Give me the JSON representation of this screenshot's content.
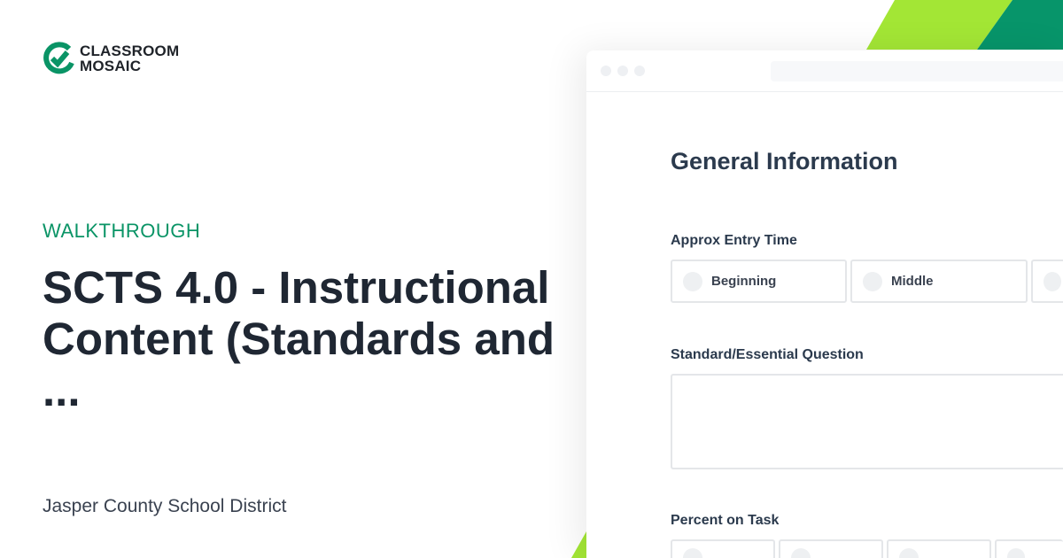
{
  "brand": {
    "logo_line1": "CLASSROOM",
    "logo_line2": "MOSAIC",
    "green": "#0a9466",
    "lime": "#a3e635"
  },
  "hero": {
    "kicker": "WALKTHROUGH",
    "title": "SCTS 4.0 - Instructional Content (Standards and ...",
    "subtitle": "Jasper County School District"
  },
  "form": {
    "section_title": "General Information",
    "entry_time": {
      "label": "Approx Entry Time",
      "options": [
        "Beginning",
        "Middle",
        ""
      ]
    },
    "standard": {
      "label": "Standard/Essential Question",
      "value": ""
    },
    "percent": {
      "label": "Percent on Task"
    }
  }
}
